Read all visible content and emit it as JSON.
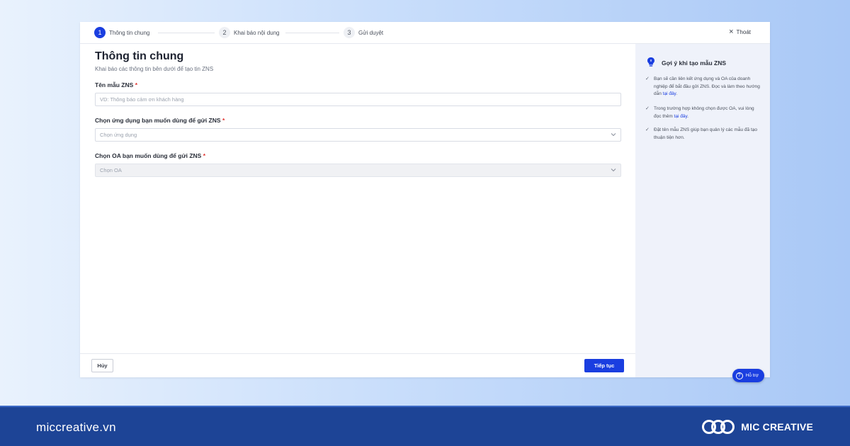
{
  "stepper": {
    "steps": [
      {
        "num": "1",
        "label": "Thông tin chung"
      },
      {
        "num": "2",
        "label": "Khai báo nội dung"
      },
      {
        "num": "3",
        "label": "Gửi duyệt"
      }
    ],
    "active_step": 1,
    "exit_label": "Thoát"
  },
  "main": {
    "title": "Thông tin chung",
    "subtitle": "Khai báo các thông tin bên dưới để tạo tin ZNS",
    "fields": [
      {
        "label": "Tên mẫu ZNS",
        "required_mark": "*",
        "placeholder": "VD: Thông báo cảm ơn khách hàng"
      },
      {
        "label": "Chọn ứng dụng bạn muốn dùng để gửi ZNS",
        "required_mark": "*",
        "placeholder": "Chọn ứng dụng"
      },
      {
        "label": "Chọn OA bạn muốn dùng để gửi ZNS",
        "required_mark": "*",
        "placeholder": "Chọn OA"
      }
    ]
  },
  "sidebar": {
    "title": "Gợi ý khi tạo mẫu ZNS",
    "tips": [
      {
        "text": "Bạn sẽ cần liên kết ứng dụng và OA của doanh nghiệp để bắt đầu gửi ZNS. Đọc và làm theo hướng dẫn ",
        "link": "tại đây",
        "suffix": "."
      },
      {
        "text": "Trong trường hợp không chọn được OA, vui lòng đọc thêm ",
        "link": "tại đây",
        "suffix": "."
      },
      {
        "text": "Đặt tên mẫu ZNS giúp bạn quản lý các mẫu đã tạo thuận tiện hơn.",
        "link": "",
        "suffix": ""
      }
    ],
    "support_label": "Hỗ trợ"
  },
  "footer": {
    "cancel_label": "Hủy",
    "next_label": "Tiếp tục"
  },
  "bottom_bar": {
    "site": "miccreative.vn",
    "brand": "MIC CREATIVE"
  },
  "colors": {
    "accent": "#1a3ee0",
    "required": "#e0342f",
    "bottom_bar": "#1d4496"
  }
}
